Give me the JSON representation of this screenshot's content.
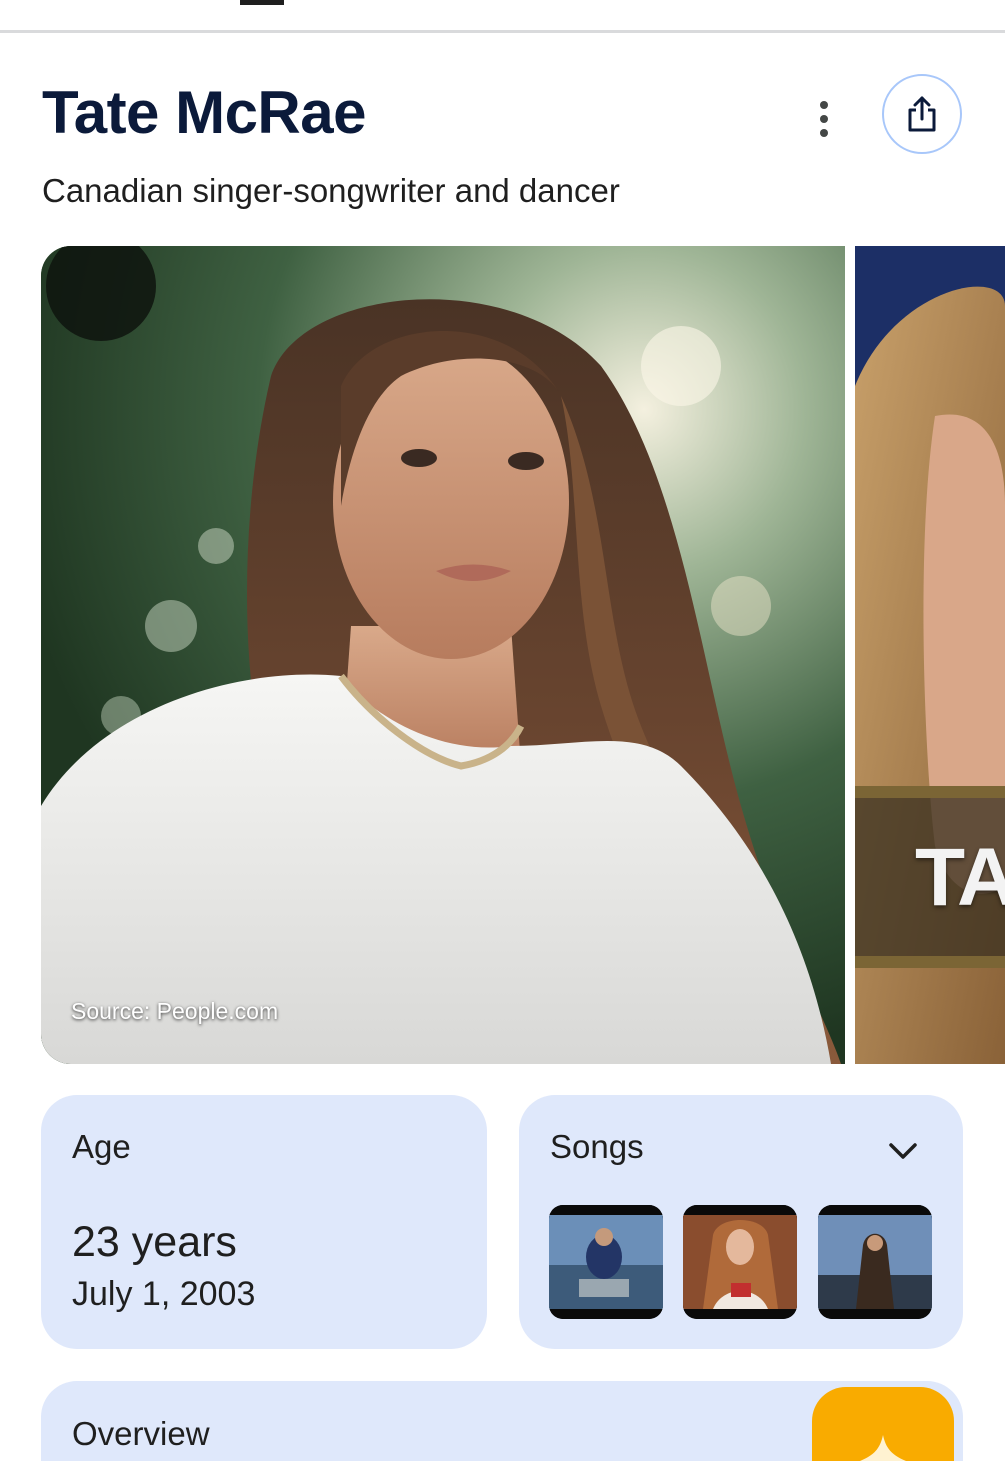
{
  "header": {
    "title": "Tate McRae",
    "subtitle": "Canadian singer-songwriter and dancer"
  },
  "actions": {
    "more_icon": "more-vert-icon",
    "share_icon": "share-icon",
    "accent": "#a8c7fa"
  },
  "images": {
    "main_source": "Source: People.com",
    "next_overlay_text": "TA"
  },
  "age_card": {
    "label": "Age",
    "value": "23 years",
    "birth_date": "July 1, 2003"
  },
  "songs_card": {
    "label": "Songs",
    "expand_icon": "chevron-down-icon",
    "thumbnails": [
      "video-thumbnail",
      "video-thumbnail",
      "video-thumbnail"
    ]
  },
  "overview_card": {
    "label": "Overview"
  },
  "colors": {
    "card_bg": "#dfe8fb",
    "title": "#0b1a3a",
    "fab": "#f9ab00"
  }
}
